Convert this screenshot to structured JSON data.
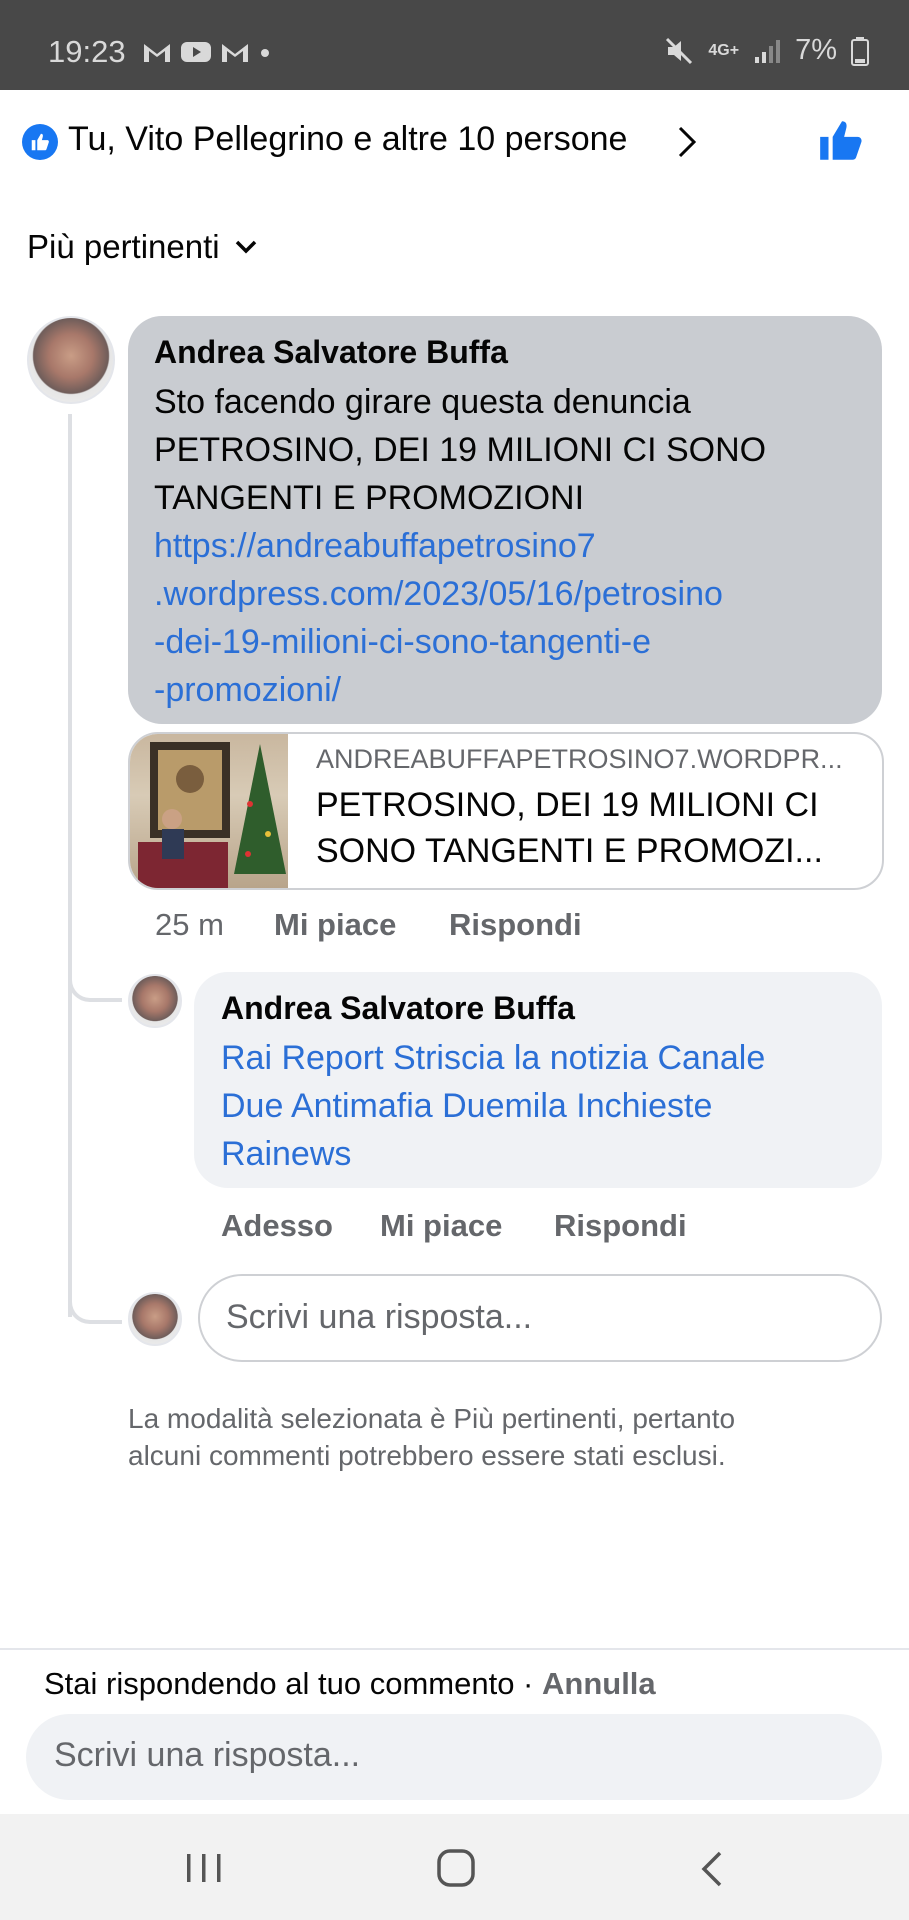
{
  "status_bar": {
    "time": "19:23",
    "battery": "7%",
    "network": "4G+"
  },
  "header": {
    "reactions_text": "Tu, Vito Pellegrino e altre 10 persone"
  },
  "sort": {
    "label": "Più pertinenti"
  },
  "comments": [
    {
      "author": "Andrea Salvatore Buffa",
      "text_lines": [
        "Sto facendo girare questa denuncia",
        "PETROSINO, DEI 19 MILIONI CI SONO",
        "TANGENTI E PROMOZIONI"
      ],
      "link_lines": [
        "https://andreabuffapetrosino7",
        ".wordpress.com/2023/05/16/petrosino",
        "-dei-19-milioni-ci-sono-tangenti-e",
        "-promozioni/"
      ],
      "preview": {
        "domain": "ANDREABUFFAPETROSINO7.WORDPR...",
        "title_lines": [
          "PETROSINO, DEI 19 MILIONI CI",
          "SONO TANGENTI E PROMOZI..."
        ]
      },
      "time": "25 m",
      "like_label": "Mi piace",
      "reply_label": "Rispondi"
    },
    {
      "author": "Andrea Salvatore Buffa",
      "text_lines": [
        "Rai Report Striscia la notizia Canale",
        "Due Antimafia Duemila Inchieste",
        "Rainews"
      ],
      "time": "Adesso",
      "like_label": "Mi piace",
      "reply_label": "Rispondi"
    }
  ],
  "inline_reply": {
    "placeholder": "Scrivi una risposta..."
  },
  "notice": {
    "lines": [
      "La modalità selezionata è Più pertinenti, pertanto",
      "alcuni commenti potrebbero essere stati esclusi."
    ]
  },
  "composer": {
    "replying_text": "Stai rispondendo al tuo commento · ",
    "cancel_label": "Annulla",
    "placeholder": "Scrivi una risposta..."
  },
  "colors": {
    "accent": "#1877f2",
    "link": "#2b6fd6",
    "bubble_highlight": "#c9ccd1",
    "bubble": "#f0f2f5"
  }
}
